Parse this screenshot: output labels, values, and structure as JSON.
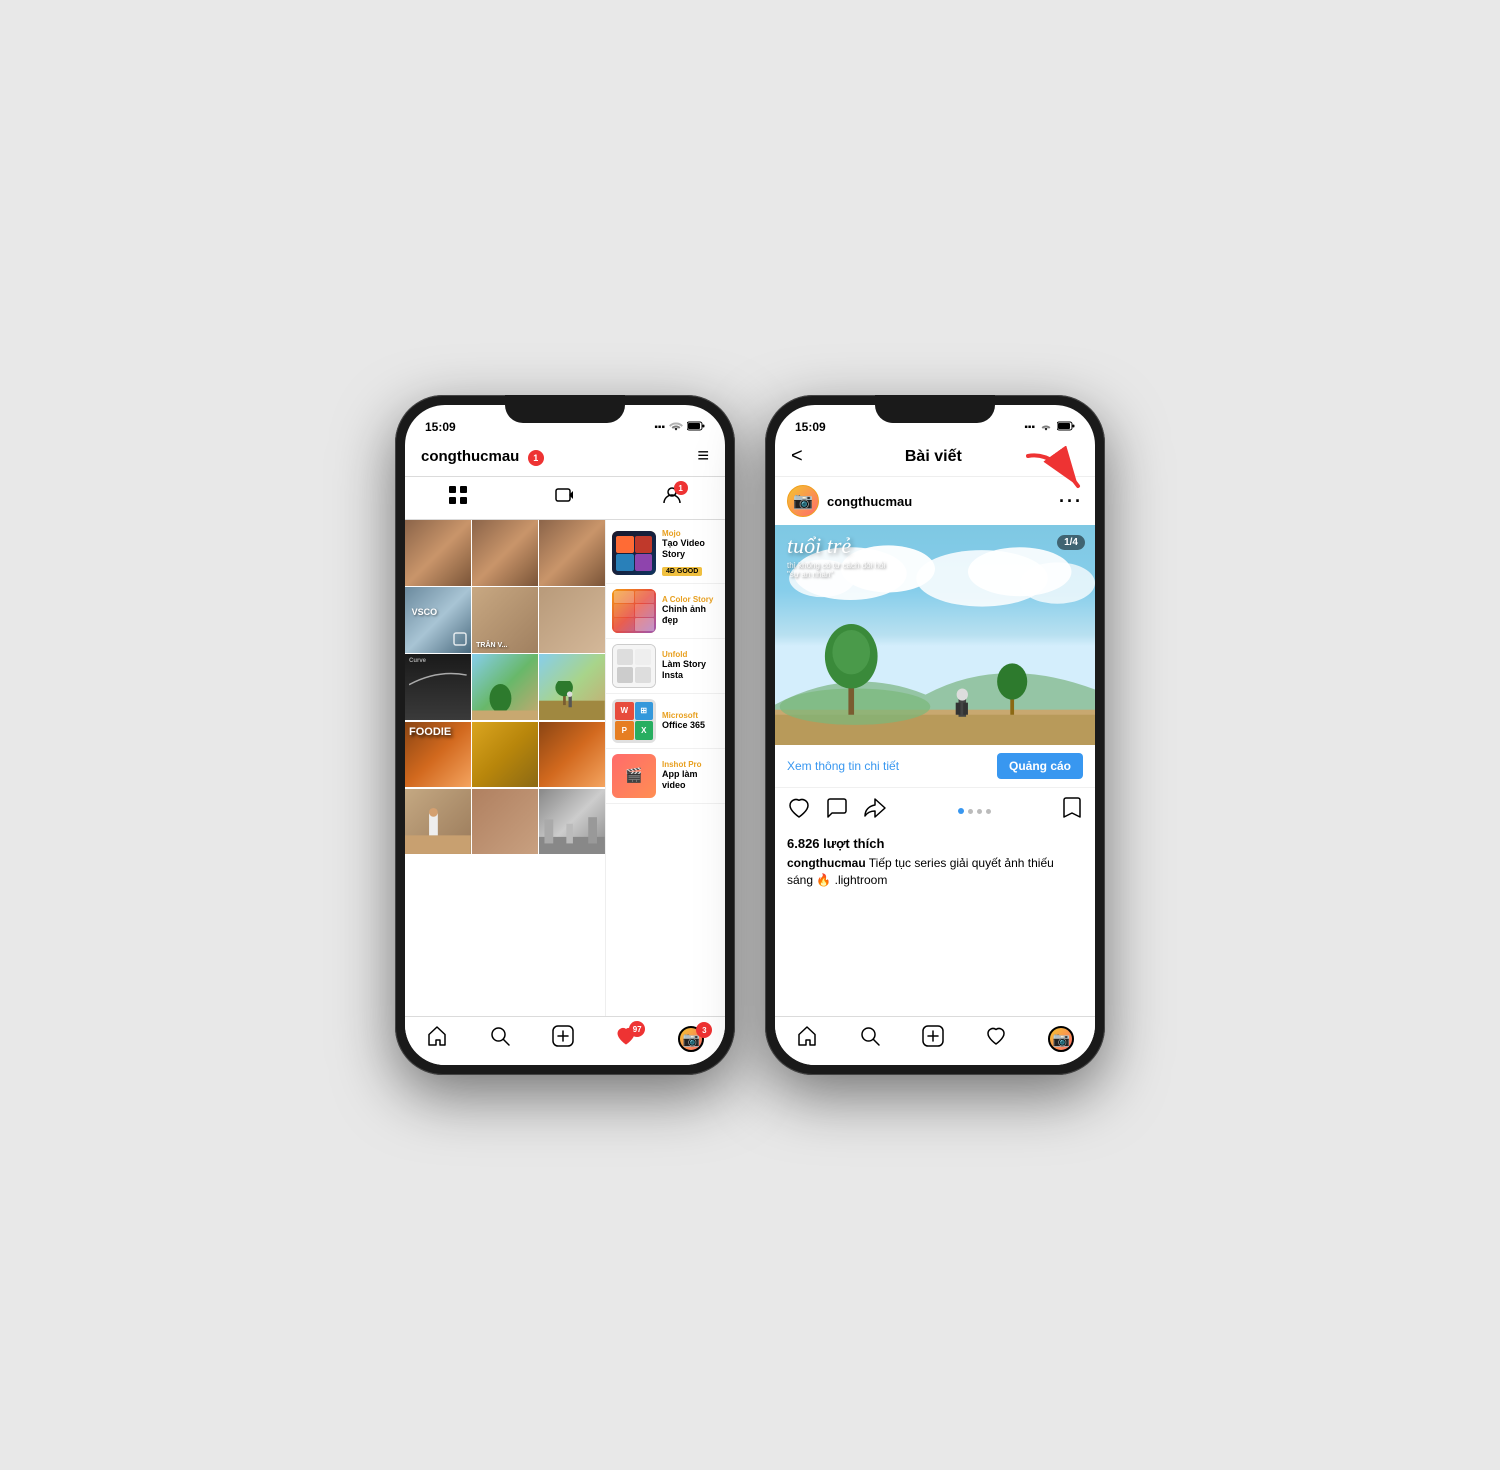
{
  "left_phone": {
    "status_bar": {
      "time": "15:09",
      "location_icon": "►",
      "signal": "▪▪▪",
      "wifi": "wifi",
      "battery": "🔋"
    },
    "header": {
      "username": "congthucmau",
      "notification_count": "1",
      "menu_icon": "≡"
    },
    "tabs": {
      "grid_icon": "⊞",
      "video_icon": "▶",
      "tagged_icon": "👤",
      "tagged_badge": "1"
    },
    "ad_items": [
      {
        "brand": "Mojo",
        "title": "Tạo Video Story",
        "badge": "4Đ GOOD"
      },
      {
        "brand": "A Color Story",
        "title": "Chỉnh ảnh đẹp",
        "badge": ""
      },
      {
        "brand": "Unfold",
        "title": "Làm Story Insta",
        "badge": ""
      },
      {
        "brand": "Microsoft",
        "title": "Office 365",
        "badge": ""
      },
      {
        "brand": "Inshot Pro",
        "title": "App làm video",
        "badge": ""
      }
    ],
    "bottom_nav": {
      "home": "🏠",
      "search": "🔍",
      "add": "➕",
      "heart": "♡",
      "heart_badge": "97",
      "people": "👥",
      "people_badge": "3"
    }
  },
  "right_phone": {
    "status_bar": {
      "time": "15:09",
      "location_icon": "►"
    },
    "header": {
      "back": "<",
      "title": "Bài viết"
    },
    "post": {
      "username": "congthucmau",
      "counter": "1/4",
      "image_text": "tuổi trẻ",
      "image_subtext": "thì không có tư cách đòi hỏi\n\"sự an nhàn\"",
      "ad_text": "Xem thông tin chi tiết",
      "ad_button": "Quảng cáo",
      "likes": "6.826 lượt thích",
      "caption_user": "congthucmau",
      "caption_text": " Tiếp tục series giải quyết ảnh thiếu sáng 🔥\n.lightroom"
    },
    "bottom_nav": {
      "home": "🏠",
      "search": "🔍",
      "add": "➕",
      "heart": "♡"
    }
  }
}
